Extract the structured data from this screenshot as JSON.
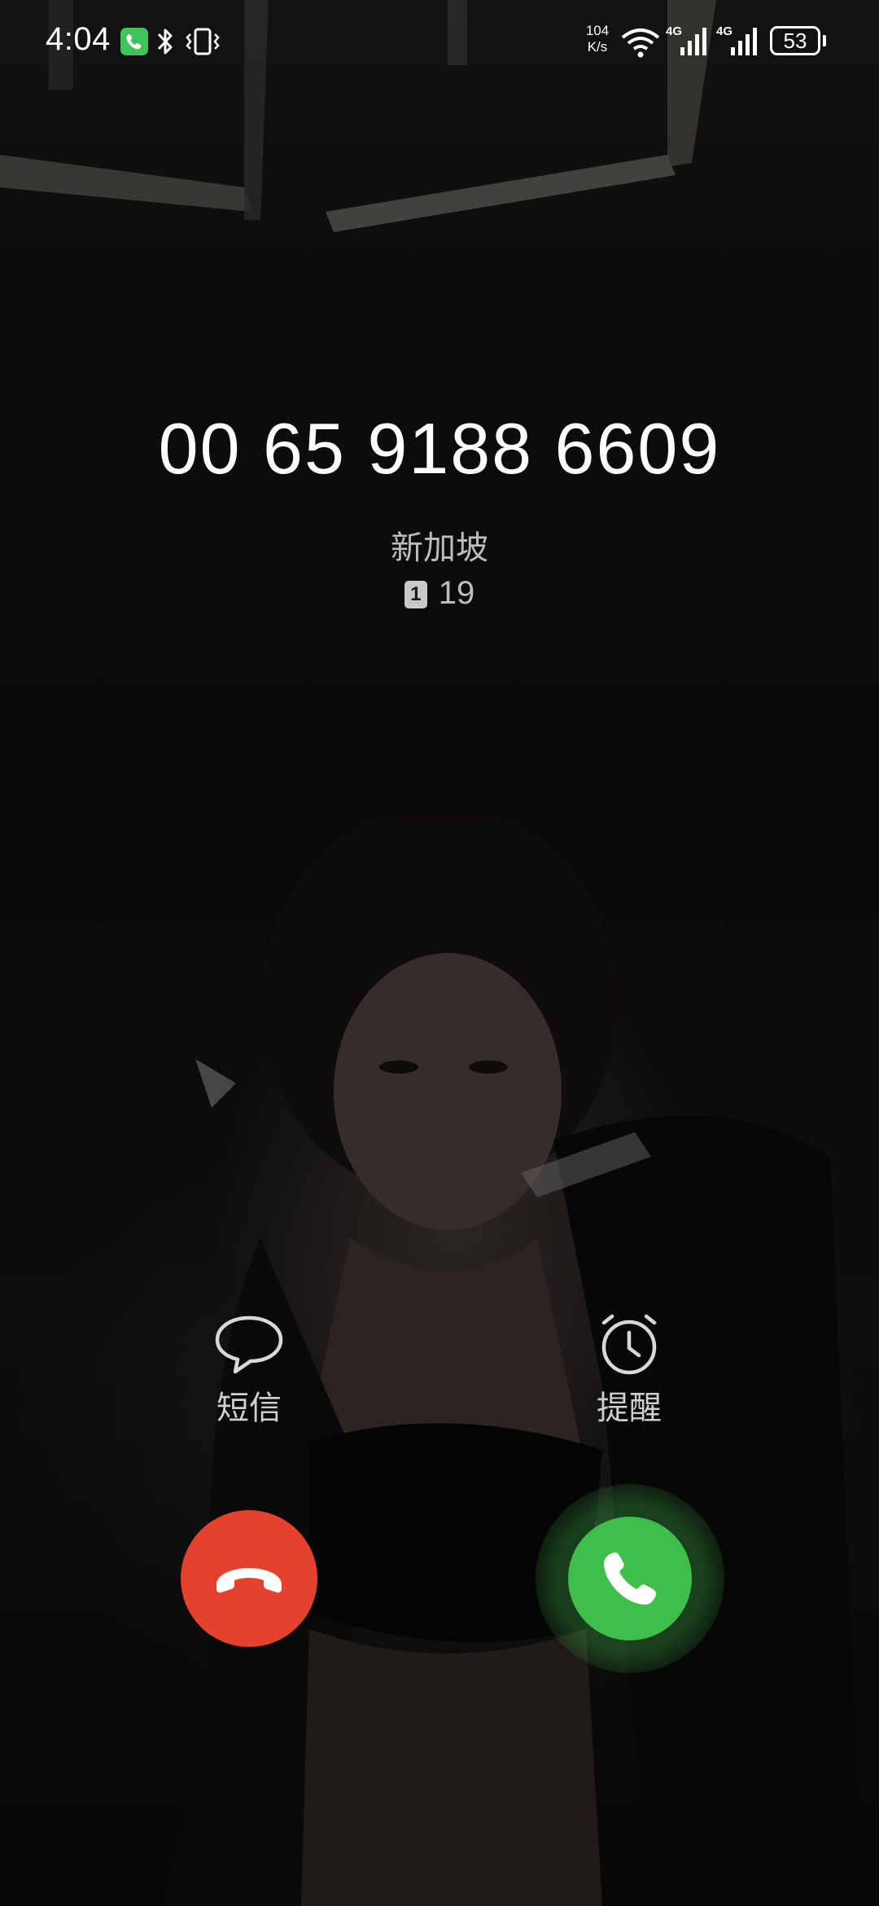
{
  "status_bar": {
    "time": "4:04",
    "call_indicator_icon": "phone-call-icon",
    "bluetooth_icon": "bluetooth-icon",
    "vibrate_icon": "vibrate-icon",
    "net_speed_value": "104",
    "net_speed_unit": "K/s",
    "wifi_icon": "wifi-icon",
    "signal1_label": "4G",
    "signal2_label": "4G",
    "battery_level": "53"
  },
  "caller": {
    "number": "00 65 9188 6609",
    "location": "新加坡",
    "sim_slot": "1",
    "sim_info": "19"
  },
  "actions": {
    "sms_label": "短信",
    "sms_icon": "message-bubble-icon",
    "remind_label": "提醒",
    "remind_icon": "alarm-clock-icon"
  },
  "buttons": {
    "decline_icon": "hang-up-icon",
    "decline_color": "#e5412f",
    "answer_icon": "phone-answer-icon",
    "answer_color": "#3fbe4c"
  }
}
